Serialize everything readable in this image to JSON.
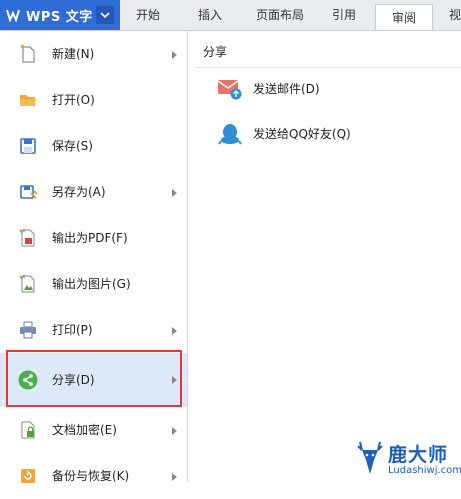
{
  "app": {
    "title": "WPS 文字"
  },
  "tabs": [
    {
      "label": "开始"
    },
    {
      "label": "插入"
    },
    {
      "label": "页面布局"
    },
    {
      "label": "引用"
    },
    {
      "label": "审阅"
    },
    {
      "label": "视"
    }
  ],
  "active_tab": "审阅",
  "menu": {
    "items": [
      {
        "label": "新建(N)",
        "icon": "new-document-icon",
        "submenu": true
      },
      {
        "label": "打开(O)",
        "icon": "open-folder-icon",
        "submenu": false
      },
      {
        "label": "保存(S)",
        "icon": "save-icon",
        "submenu": false
      },
      {
        "label": "另存为(A)",
        "icon": "save-as-icon",
        "submenu": true
      },
      {
        "label": "输出为PDF(F)",
        "icon": "pdf-export-icon",
        "submenu": false
      },
      {
        "label": "输出为图片(G)",
        "icon": "image-export-icon",
        "submenu": false
      },
      {
        "label": "打印(P)",
        "icon": "printer-icon",
        "submenu": true
      },
      {
        "label": "分享(D)",
        "icon": "share-icon",
        "submenu": true,
        "selected": true
      },
      {
        "label": "文档加密(E)",
        "icon": "encrypt-icon",
        "submenu": true
      },
      {
        "label": "备份与恢复(K)",
        "icon": "backup-icon",
        "submenu": true
      }
    ]
  },
  "panel": {
    "title": "分享",
    "items": [
      {
        "label": "发送邮件(D)",
        "icon": "email-icon"
      },
      {
        "label": "发送给QQ好友(Q)",
        "icon": "qq-icon"
      }
    ]
  },
  "watermark": {
    "title": "鹿大师",
    "url": "Ludashiwj.com"
  },
  "colors": {
    "brand": "#2f6cd6",
    "selected_bg": "#dde8f8",
    "highlight": "#e23a3a",
    "share_green": "#4caf50"
  }
}
